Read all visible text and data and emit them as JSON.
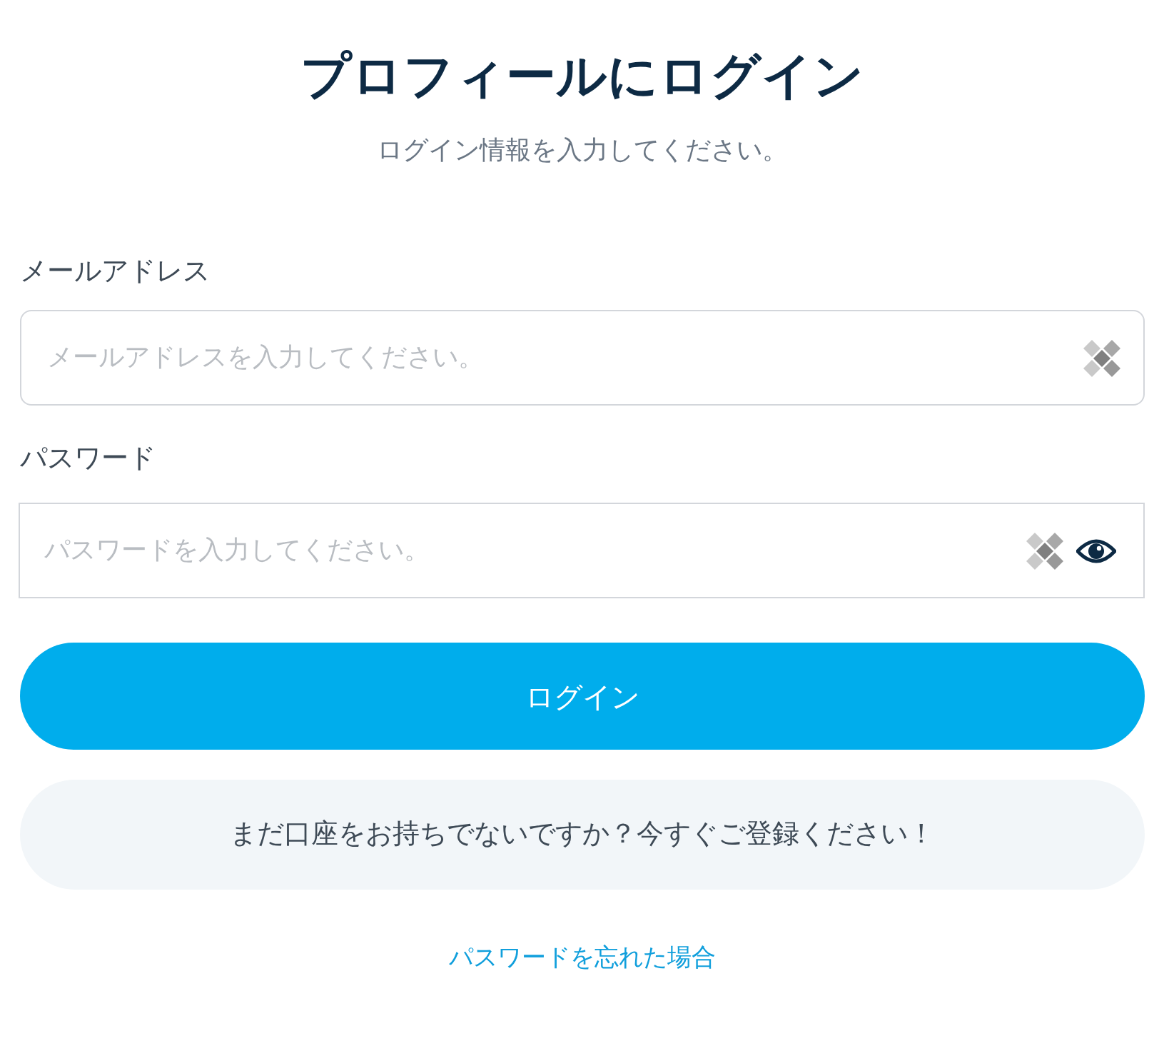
{
  "title": "プロフィールにログイン",
  "subtitle": "ログイン情報を入力してください。",
  "fields": [
    {
      "kind": "email",
      "label": "メールアドレス",
      "placeholder": "メールアドレスを入力してください。"
    },
    {
      "kind": "password",
      "label": "パスワード",
      "placeholder": "パスワードを入力してください。"
    }
  ],
  "login_button": "ログイン",
  "register_button": "まだ口座をお持ちでないですか？今すぐご登録ください！",
  "forgot_link": "パスワードを忘れた場合"
}
